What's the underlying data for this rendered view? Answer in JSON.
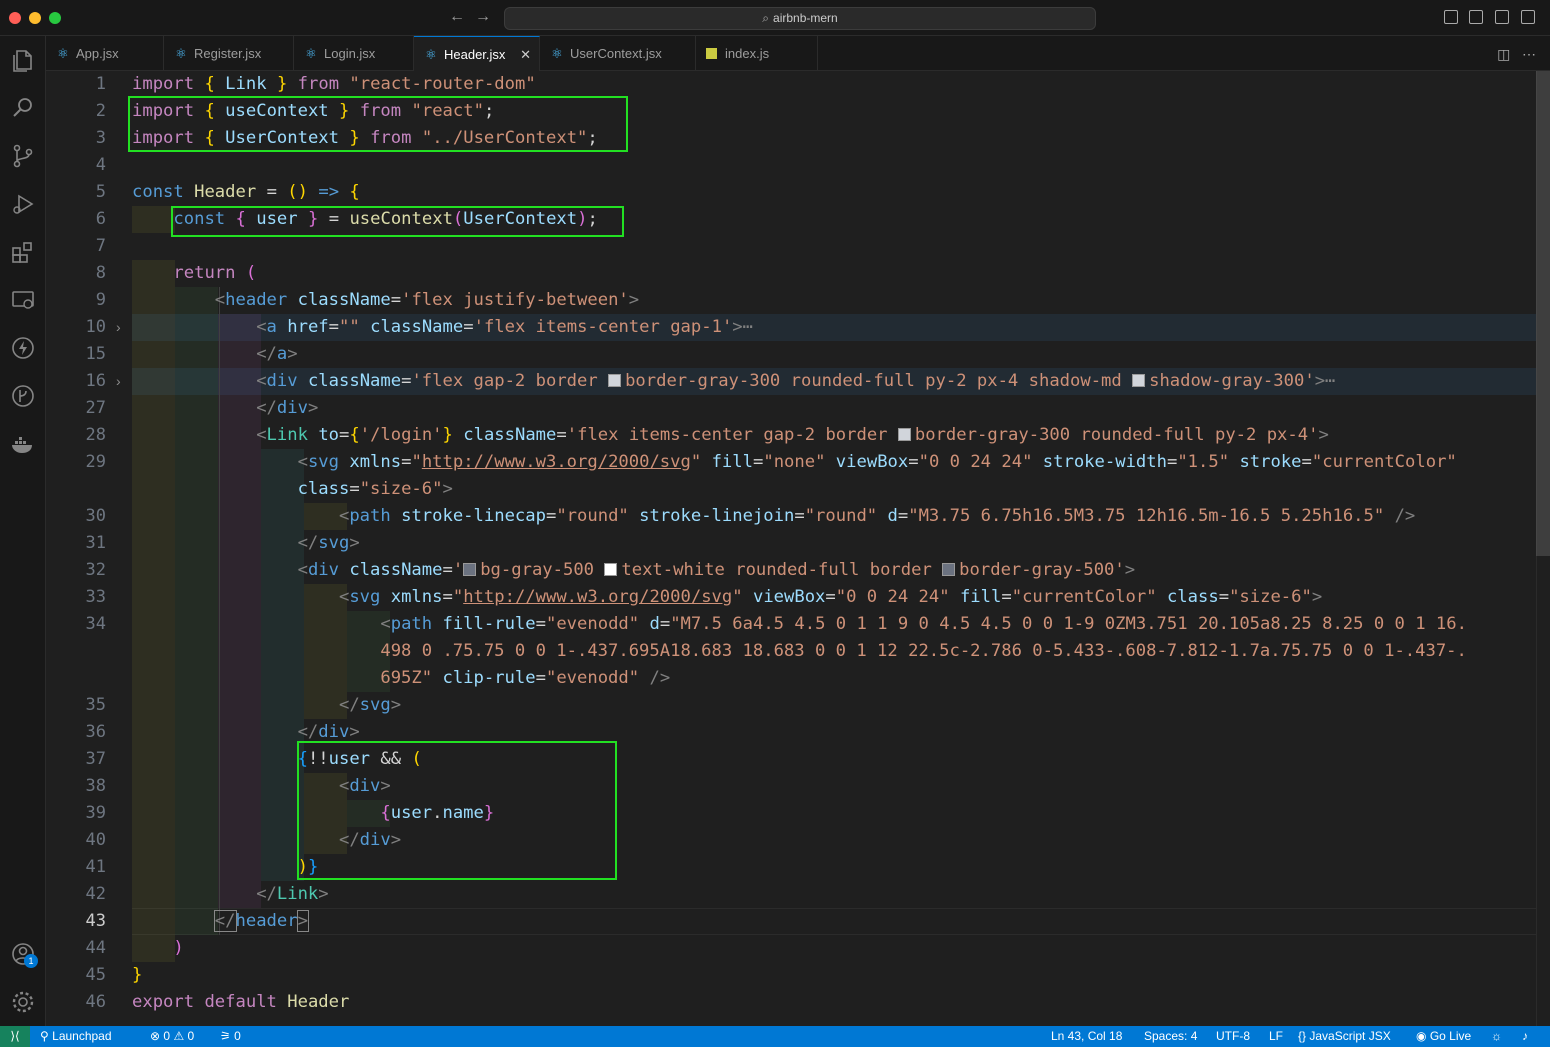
{
  "window": {
    "search_text": "airbnb-mern"
  },
  "tabs": [
    {
      "label": "App.jsx",
      "icon": "react-icon"
    },
    {
      "label": "Register.jsx",
      "icon": "react-icon"
    },
    {
      "label": "Login.jsx",
      "icon": "react-icon"
    },
    {
      "label": "Header.jsx",
      "icon": "react-icon",
      "active": true
    },
    {
      "label": "UserContext.jsx",
      "icon": "react-icon"
    },
    {
      "label": "index.js",
      "icon": "js-icon"
    }
  ],
  "gutter": [
    "1",
    "2",
    "3",
    "4",
    "5",
    "6",
    "7",
    "8",
    "9",
    "10",
    "15",
    "16",
    "27",
    "28",
    "29",
    "",
    "30",
    "31",
    "32",
    "33",
    "34",
    "",
    "",
    "35",
    "36",
    "37",
    "38",
    "39",
    "40",
    "41",
    "42",
    "43",
    "44",
    "45",
    "46"
  ],
  "status": {
    "launchpad": "Launchpad",
    "errors": "0",
    "warnings": "0",
    "ports": "0",
    "position": "Ln 43, Col 18",
    "spaces": "Spaces: 4",
    "encoding": "UTF-8",
    "eol": "LF",
    "language": "JavaScript JSX",
    "golive": "Go Live"
  },
  "code": {
    "l1": [
      "import",
      "{",
      "Link",
      "}",
      "from",
      "\"react-router-dom\""
    ],
    "l2": [
      "import",
      "{",
      "useContext",
      "}",
      "from",
      "\"react\"",
      ";"
    ],
    "l3": [
      "import",
      "{",
      "UserContext",
      "}",
      "from",
      "\"../UserContext\"",
      ";"
    ],
    "l5": [
      "const",
      "Header",
      "=",
      "()",
      "=>",
      "{"
    ],
    "l6": [
      "const",
      "{",
      "user",
      "}",
      "=",
      "useContext",
      "(",
      "UserContext",
      ")",
      ";"
    ],
    "l8": [
      "return",
      "("
    ],
    "l9": [
      "<",
      "header",
      "className",
      "=",
      "'flex justify-between'",
      ">"
    ],
    "l10": [
      "<",
      "a",
      "href",
      "=",
      "\"\"",
      "className",
      "=",
      "'flex items-center gap-1'",
      ">",
      "⋯"
    ],
    "l15": [
      "</",
      "a",
      ">"
    ],
    "l16": [
      "<",
      "div",
      "className",
      "=",
      "'flex gap-2 border ",
      "border-gray-300 rounded-full py-2 px-4 shadow-md ",
      "shadow-gray-300'",
      ">",
      "⋯"
    ],
    "l27": [
      "</",
      "div",
      ">"
    ],
    "l28": [
      "<",
      "Link",
      "to",
      "=",
      "{",
      "'/login'",
      "}",
      "className",
      "=",
      "'flex items-center gap-2 border ",
      "border-gray-300 rounded-full py-2 px-4'",
      ">"
    ],
    "l29": [
      "<",
      "svg",
      "xmlns",
      "=",
      "\"",
      "http://www.w3.org/2000/svg",
      "\"",
      "fill",
      "=",
      "\"none\"",
      "viewBox",
      "=",
      "\"0 0 24 24\"",
      "stroke-width",
      "=",
      "\"1.5\"",
      "stroke",
      "=",
      "\"currentColor\""
    ],
    "l29b": [
      "class",
      "=",
      "\"size-6\"",
      ">"
    ],
    "l30": [
      "<",
      "path",
      "stroke-linecap",
      "=",
      "\"round\"",
      "stroke-linejoin",
      "=",
      "\"round\"",
      "d",
      "=",
      "\"M3.75 6.75h16.5M3.75 12h16.5m-16.5 5.25h16.5\"",
      "/>"
    ],
    "l31": [
      "</",
      "svg",
      ">"
    ],
    "l32": [
      "<",
      "div",
      "className",
      "=",
      "'",
      "bg-gray-500 ",
      "text-white rounded-full border ",
      "border-gray-500'",
      ">"
    ],
    "l33": [
      "<",
      "svg",
      "xmlns",
      "=",
      "\"",
      "http://www.w3.org/2000/svg",
      "\"",
      "viewBox",
      "=",
      "\"0 0 24 24\"",
      "fill",
      "=",
      "\"currentColor\"",
      "class",
      "=",
      "\"size-6\"",
      ">"
    ],
    "l34": [
      "<",
      "path",
      "fill-rule",
      "=",
      "\"evenodd\"",
      "d",
      "=",
      "\"M7.5 6a4.5 4.5 0 1 1 9 0 4.5 4.5 0 0 1-9 0ZM3.751 20.105a8.25 8.25 0 0 1 16."
    ],
    "l34b": [
      "498 0 .75.75 0 0 1-.437.695A18.683 18.683 0 0 1 12 22.5c-2.786 0-5.433-.608-7.812-1.7a.75.75 0 0 1-.437-."
    ],
    "l34c": [
      "695Z\"",
      "clip-rule",
      "=",
      "\"evenodd\"",
      "/>"
    ],
    "l35": [
      "</",
      "svg",
      ">"
    ],
    "l36": [
      "</",
      "div",
      ">"
    ],
    "l37": [
      "{",
      "!!",
      "user",
      "&&",
      "("
    ],
    "l38": [
      "<",
      "div",
      ">"
    ],
    "l39": [
      "{",
      "user",
      ".",
      "name",
      "}"
    ],
    "l40": [
      "</",
      "div",
      ">"
    ],
    "l41": [
      ")",
      "}"
    ],
    "l42": [
      "</",
      "Link",
      ">"
    ],
    "l43": [
      "</",
      "header",
      ">"
    ],
    "l44": [
      ")"
    ],
    "l45": [
      "}"
    ],
    "l46": [
      "export",
      "default",
      "Header"
    ]
  },
  "colors": {
    "box": "#22e022",
    "statusbar": "#0078d4"
  }
}
